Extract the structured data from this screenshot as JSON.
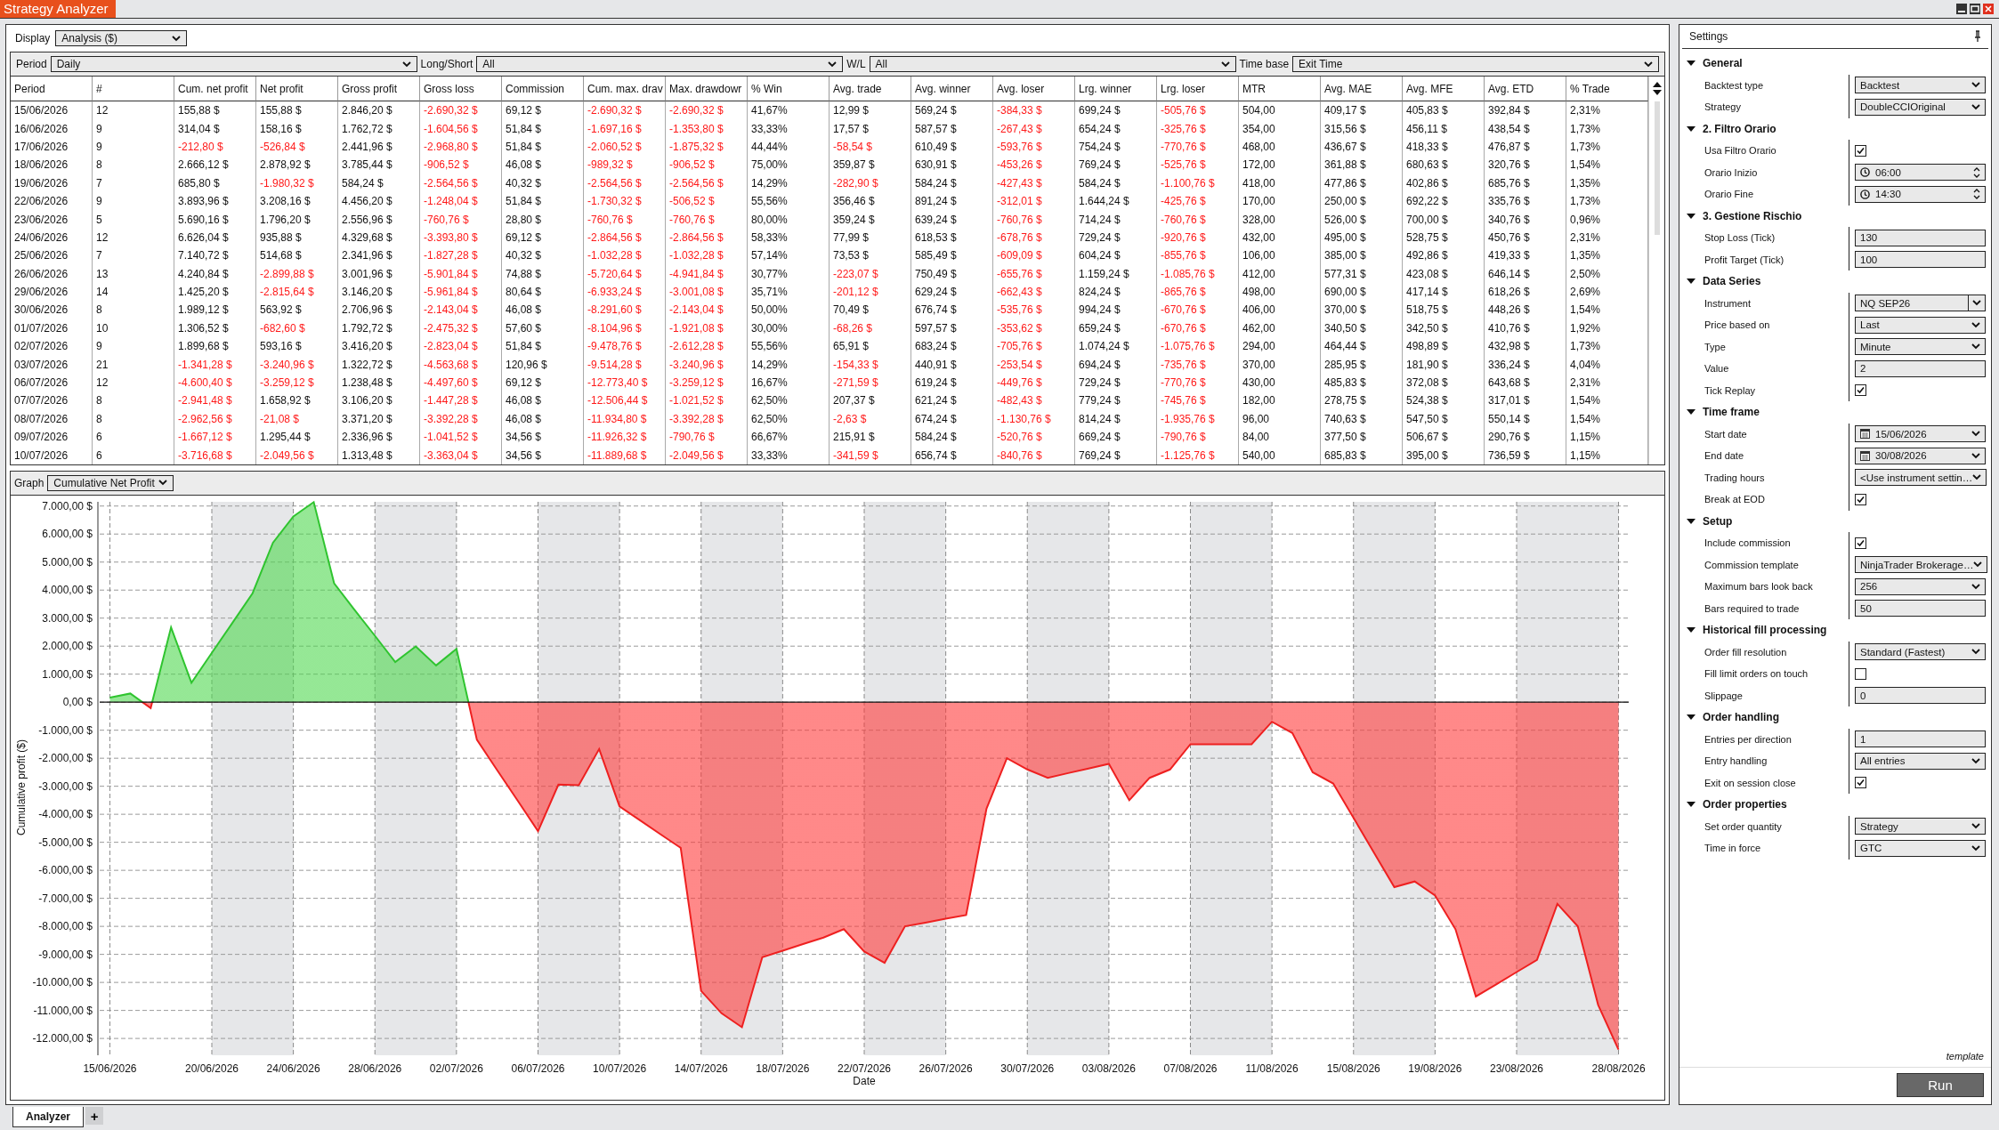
{
  "window": {
    "title": "Strategy Analyzer"
  },
  "display": {
    "label": "Display",
    "value": "Analysis ($)"
  },
  "filters": [
    {
      "label": "Period",
      "value": "Daily"
    },
    {
      "label": "Long/Short",
      "value": "All"
    },
    {
      "label": "W/L",
      "value": "All"
    },
    {
      "label": "Time base",
      "value": "Exit Time"
    }
  ],
  "table": {
    "columns": [
      "Period",
      "#",
      "Cum. net profit",
      "Net profit",
      "Gross profit",
      "Gross loss",
      "Commission",
      "Cum. max. drav",
      "Max. drawdowr",
      "% Win",
      "Avg. trade",
      "Avg. winner",
      "Avg. loser",
      "Lrg. winner",
      "Lrg. loser",
      "MTR",
      "Avg. MAE",
      "Avg. MFE",
      "Avg. ETD",
      "% Trade"
    ],
    "rows": [
      [
        "15/06/2026",
        "12",
        "155,88 $",
        "155,88 $",
        "2.846,20 $",
        "-2.690,32 $",
        "69,12 $",
        "-2.690,32 $",
        "-2.690,32 $",
        "41,67%",
        "12,99 $",
        "569,24 $",
        "-384,33 $",
        "699,24 $",
        "-505,76 $",
        "504,00",
        "409,17 $",
        "405,83 $",
        "392,84 $",
        "2,31%"
      ],
      [
        "16/06/2026",
        "9",
        "314,04 $",
        "158,16 $",
        "1.762,72 $",
        "-1.604,56 $",
        "51,84 $",
        "-1.697,16 $",
        "-1.353,80 $",
        "33,33%",
        "17,57 $",
        "587,57 $",
        "-267,43 $",
        "654,24 $",
        "-325,76 $",
        "354,00",
        "315,56 $",
        "456,11 $",
        "438,54 $",
        "1,73%"
      ],
      [
        "17/06/2026",
        "9",
        "-212,80 $",
        "-526,84 $",
        "2.441,96 $",
        "-2.968,80 $",
        "51,84 $",
        "-2.060,52 $",
        "-1.875,32 $",
        "44,44%",
        "-58,54 $",
        "610,49 $",
        "-593,76 $",
        "754,24 $",
        "-770,76 $",
        "468,00",
        "436,67 $",
        "418,33 $",
        "476,87 $",
        "1,73%"
      ],
      [
        "18/06/2026",
        "8",
        "2.666,12 $",
        "2.878,92 $",
        "3.785,44 $",
        "-906,52 $",
        "46,08 $",
        "-989,32 $",
        "-906,52 $",
        "75,00%",
        "359,87 $",
        "630,91 $",
        "-453,26 $",
        "769,24 $",
        "-525,76 $",
        "172,00",
        "361,88 $",
        "680,63 $",
        "320,76 $",
        "1,54%"
      ],
      [
        "19/06/2026",
        "7",
        "685,80 $",
        "-1.980,32 $",
        "584,24 $",
        "-2.564,56 $",
        "40,32 $",
        "-2.564,56 $",
        "-2.564,56 $",
        "14,29%",
        "-282,90 $",
        "584,24 $",
        "-427,43 $",
        "584,24 $",
        "-1.100,76 $",
        "418,00",
        "477,86 $",
        "402,86 $",
        "685,76 $",
        "1,35%"
      ],
      [
        "22/06/2026",
        "9",
        "3.893,96 $",
        "3.208,16 $",
        "4.456,20 $",
        "-1.248,04 $",
        "51,84 $",
        "-1.730,32 $",
        "-506,52 $",
        "55,56%",
        "356,46 $",
        "891,24 $",
        "-312,01 $",
        "1.644,24 $",
        "-425,76 $",
        "170,00",
        "250,00 $",
        "692,22 $",
        "335,76 $",
        "1,73%"
      ],
      [
        "23/06/2026",
        "5",
        "5.690,16 $",
        "1.796,20 $",
        "2.556,96 $",
        "-760,76 $",
        "28,80 $",
        "-760,76 $",
        "-760,76 $",
        "80,00%",
        "359,24 $",
        "639,24 $",
        "-760,76 $",
        "714,24 $",
        "-760,76 $",
        "328,00",
        "526,00 $",
        "700,00 $",
        "340,76 $",
        "0,96%"
      ],
      [
        "24/06/2026",
        "12",
        "6.626,04 $",
        "935,88 $",
        "4.329,68 $",
        "-3.393,80 $",
        "69,12 $",
        "-2.864,56 $",
        "-2.864,56 $",
        "58,33%",
        "77,99 $",
        "618,53 $",
        "-678,76 $",
        "729,24 $",
        "-920,76 $",
        "432,00",
        "495,00 $",
        "528,75 $",
        "450,76 $",
        "2,31%"
      ],
      [
        "25/06/2026",
        "7",
        "7.140,72 $",
        "514,68 $",
        "2.341,96 $",
        "-1.827,28 $",
        "40,32 $",
        "-1.032,28 $",
        "-1.032,28 $",
        "57,14%",
        "73,53 $",
        "585,49 $",
        "-609,09 $",
        "604,24 $",
        "-855,76 $",
        "106,00",
        "385,00 $",
        "492,86 $",
        "419,33 $",
        "1,35%"
      ],
      [
        "26/06/2026",
        "13",
        "4.240,84 $",
        "-2.899,88 $",
        "3.001,96 $",
        "-5.901,84 $",
        "74,88 $",
        "-5.720,64 $",
        "-4.941,84 $",
        "30,77%",
        "-223,07 $",
        "750,49 $",
        "-655,76 $",
        "1.159,24 $",
        "-1.085,76 $",
        "412,00",
        "577,31 $",
        "423,08 $",
        "646,14 $",
        "2,50%"
      ],
      [
        "29/06/2026",
        "14",
        "1.425,20 $",
        "-2.815,64 $",
        "3.146,20 $",
        "-5.961,84 $",
        "80,64 $",
        "-6.933,24 $",
        "-3.001,08 $",
        "35,71%",
        "-201,12 $",
        "629,24 $",
        "-662,43 $",
        "824,24 $",
        "-865,76 $",
        "498,00",
        "690,00 $",
        "417,14 $",
        "618,26 $",
        "2,69%"
      ],
      [
        "30/06/2026",
        "8",
        "1.989,12 $",
        "563,92 $",
        "2.706,96 $",
        "-2.143,04 $",
        "46,08 $",
        "-8.291,60 $",
        "-2.143,04 $",
        "50,00%",
        "70,49 $",
        "676,74 $",
        "-535,76 $",
        "994,24 $",
        "-670,76 $",
        "406,00",
        "370,00 $",
        "518,75 $",
        "448,26 $",
        "1,54%"
      ],
      [
        "01/07/2026",
        "10",
        "1.306,52 $",
        "-682,60 $",
        "1.792,72 $",
        "-2.475,32 $",
        "57,60 $",
        "-8.104,96 $",
        "-1.921,08 $",
        "30,00%",
        "-68,26 $",
        "597,57 $",
        "-353,62 $",
        "659,24 $",
        "-670,76 $",
        "462,00",
        "340,50 $",
        "342,50 $",
        "410,76 $",
        "1,92%"
      ],
      [
        "02/07/2026",
        "9",
        "1.899,68 $",
        "593,16 $",
        "3.416,20 $",
        "-2.823,04 $",
        "51,84 $",
        "-9.478,76 $",
        "-2.612,28 $",
        "55,56%",
        "65,91 $",
        "683,24 $",
        "-705,76 $",
        "1.074,24 $",
        "-1.075,76 $",
        "294,00",
        "464,44 $",
        "498,89 $",
        "432,98 $",
        "1,73%"
      ],
      [
        "03/07/2026",
        "21",
        "-1.341,28 $",
        "-3.240,96 $",
        "1.322,72 $",
        "-4.563,68 $",
        "120,96 $",
        "-9.514,28 $",
        "-3.240,96 $",
        "14,29%",
        "-154,33 $",
        "440,91 $",
        "-253,54 $",
        "694,24 $",
        "-735,76 $",
        "370,00",
        "285,95 $",
        "181,90 $",
        "336,24 $",
        "4,04%"
      ],
      [
        "06/07/2026",
        "12",
        "-4.600,40 $",
        "-3.259,12 $",
        "1.238,48 $",
        "-4.497,60 $",
        "69,12 $",
        "-12.773,40 $",
        "-3.259,12 $",
        "16,67%",
        "-271,59 $",
        "619,24 $",
        "-449,76 $",
        "729,24 $",
        "-770,76 $",
        "430,00",
        "485,83 $",
        "372,08 $",
        "643,68 $",
        "2,31%"
      ],
      [
        "07/07/2026",
        "8",
        "-2.941,48 $",
        "1.658,92 $",
        "3.106,20 $",
        "-1.447,28 $",
        "46,08 $",
        "-12.506,44 $",
        "-1.021,52 $",
        "62,50%",
        "207,37 $",
        "621,24 $",
        "-482,43 $",
        "779,24 $",
        "-745,76 $",
        "182,00",
        "278,75 $",
        "524,38 $",
        "317,01 $",
        "1,54%"
      ],
      [
        "08/07/2026",
        "8",
        "-2.962,56 $",
        "-21,08 $",
        "3.371,20 $",
        "-3.392,28 $",
        "46,08 $",
        "-11.934,80 $",
        "-3.392,28 $",
        "62,50%",
        "-2,63 $",
        "674,24 $",
        "-1.130,76 $",
        "814,24 $",
        "-1.935,76 $",
        "96,00",
        "740,63 $",
        "547,50 $",
        "550,14 $",
        "1,54%"
      ],
      [
        "09/07/2026",
        "6",
        "-1.667,12 $",
        "1.295,44 $",
        "2.336,96 $",
        "-1.041,52 $",
        "34,56 $",
        "-11.926,32 $",
        "-790,76 $",
        "66,67%",
        "215,91 $",
        "584,24 $",
        "-520,76 $",
        "669,24 $",
        "-790,76 $",
        "84,00",
        "377,50 $",
        "506,67 $",
        "290,76 $",
        "1,15%"
      ],
      [
        "10/07/2026",
        "6",
        "-3.716,68 $",
        "-2.049,56 $",
        "1.313,48 $",
        "-3.363,04 $",
        "34,56 $",
        "-11.889,68 $",
        "-2.049,56 $",
        "33,33%",
        "-341,59 $",
        "656,74 $",
        "-840,76 $",
        "769,24 $",
        "-1.125,76 $",
        "540,00",
        "685,83 $",
        "395,00 $",
        "736,59 $",
        "1,15%"
      ]
    ]
  },
  "graph": {
    "label": "Graph",
    "value": "Cumulative Net Profit",
    "chart_data": {
      "type": "area",
      "xlabel": "Date",
      "ylabel": "Cumulative profit ($)",
      "categories": [
        "15/06/2026",
        null,
        null,
        null,
        null,
        "20/06/2026",
        null,
        null,
        null,
        "24/06/2026",
        null,
        null,
        null,
        "28/06/2026",
        null,
        null,
        null,
        "02/07/2026",
        null,
        null,
        null,
        "06/07/2026",
        null,
        null,
        null,
        "10/07/2026",
        null,
        null,
        null,
        "14/07/2026",
        null,
        null,
        null,
        "18/07/2026",
        null,
        null,
        null,
        "22/07/2026",
        null,
        null,
        null,
        "26/07/2026",
        null,
        null,
        null,
        "30/07/2026",
        null,
        null,
        null,
        "03/08/2026",
        null,
        null,
        null,
        "07/08/2026",
        null,
        null,
        null,
        "11/08/2026",
        null,
        null,
        null,
        "15/08/2026",
        null,
        null,
        null,
        "19/08/2026",
        null,
        null,
        null,
        "23/08/2026",
        null,
        null,
        null,
        null,
        "28/08/2026"
      ],
      "series": [
        {
          "values": [
            160,
            310,
            -210,
            2670,
            690,
            1760,
            2820,
            3890,
            5690,
            6630,
            7140,
            4240,
            3300,
            2370,
            1430,
            1990,
            1310,
            1900,
            -1340,
            -2430,
            -3510,
            -4600,
            -2940,
            -2960,
            -1670,
            -3720,
            -4210,
            -4710,
            -5200,
            -10300,
            -11100,
            -11600,
            -9100,
            -8870,
            -8630,
            -8400,
            -8100,
            -8900,
            -9300,
            -8000,
            -7870,
            -7730,
            -7600,
            -3800,
            -2000,
            -2400,
            -2700,
            -2530,
            -2370,
            -2200,
            -3500,
            -2700,
            -2400,
            -1500,
            -1500,
            -1500,
            -1500,
            -700,
            -1100,
            -2500,
            -2900,
            -4130,
            -5370,
            -6600,
            -6400,
            -6900,
            -8100,
            -10500,
            -10070,
            -9630,
            -9200,
            -7200,
            -8000,
            -10800,
            -12400
          ]
        }
      ],
      "ylim": [
        -12600,
        7150
      ],
      "yticks": [
        {
          "value": 7000,
          "label": "7.000,00 $"
        },
        {
          "value": 6000,
          "label": "6.000,00 $"
        },
        {
          "value": 5000,
          "label": "5.000,00 $"
        },
        {
          "value": 4000,
          "label": "4.000,00 $"
        },
        {
          "value": 3000,
          "label": "3.000,00 $"
        },
        {
          "value": 2000,
          "label": "2.000,00 $"
        },
        {
          "value": 1000,
          "label": "1.000,00 $"
        },
        {
          "value": 0,
          "label": "0,00 $"
        },
        {
          "value": -1000,
          "label": "-1.000,00 $"
        },
        {
          "value": -2000,
          "label": "-2.000,00 $"
        },
        {
          "value": -3000,
          "label": "-3.000,00 $"
        },
        {
          "value": -4000,
          "label": "-4.000,00 $"
        },
        {
          "value": -5000,
          "label": "-5.000,00 $"
        },
        {
          "value": -6000,
          "label": "-6.000,00 $"
        },
        {
          "value": -7000,
          "label": "-7.000,00 $"
        },
        {
          "value": -8000,
          "label": "-8.000,00 $"
        },
        {
          "value": -9000,
          "label": "-9.000,00 $"
        },
        {
          "value": -10000,
          "label": "-10.000,00 $"
        },
        {
          "value": -11000,
          "label": "-11.000,00 $"
        },
        {
          "value": -12000,
          "label": "-12.000,00 $"
        }
      ],
      "grid": true
    }
  },
  "settings": {
    "title": "Settings",
    "groups": [
      {
        "title": "General",
        "expanded": true,
        "rows": [
          {
            "label": "Backtest type",
            "kind": "dropdown",
            "value": "Backtest"
          },
          {
            "label": "Strategy",
            "kind": "dropdown",
            "value": "DoubleCCIOriginal"
          }
        ]
      },
      {
        "title": "2. Filtro Orario",
        "expanded": true,
        "rows": [
          {
            "label": "Usa Filtro Orario",
            "kind": "checkbox",
            "checked": true
          },
          {
            "label": "Orario Inizio",
            "kind": "time",
            "value": "06:00"
          },
          {
            "label": "Orario Fine",
            "kind": "time",
            "value": "14:30"
          }
        ]
      },
      {
        "title": "3. Gestione Rischio",
        "expanded": true,
        "rows": [
          {
            "label": "Stop Loss (Tick)",
            "kind": "text",
            "value": "130"
          },
          {
            "label": "Profit Target (Tick)",
            "kind": "text",
            "value": "100"
          }
        ]
      },
      {
        "title": "Data Series",
        "expanded": true,
        "rows": [
          {
            "label": "Instrument",
            "kind": "combo",
            "value": "NQ SEP26"
          },
          {
            "label": "Price based on",
            "kind": "dropdown",
            "value": "Last"
          },
          {
            "label": "Type",
            "kind": "dropdown",
            "value": "Minute"
          },
          {
            "label": "Value",
            "kind": "text",
            "value": "2"
          },
          {
            "label": "Tick Replay",
            "kind": "checkbox",
            "checked": true
          }
        ]
      },
      {
        "title": "Time frame",
        "expanded": true,
        "rows": [
          {
            "label": "Start date",
            "kind": "date",
            "value": "15/06/2026"
          },
          {
            "label": "End date",
            "kind": "date",
            "value": "30/08/2026"
          },
          {
            "label": "Trading hours",
            "kind": "dropdown",
            "value": "<Use instrument settin…"
          },
          {
            "label": "Break at EOD",
            "kind": "checkbox",
            "checked": true
          }
        ]
      },
      {
        "title": "Setup",
        "expanded": true,
        "rows": [
          {
            "label": "Include commission",
            "kind": "checkbox",
            "checked": true
          },
          {
            "label": "Commission template",
            "kind": "dropdown",
            "value": "NinjaTrader Brokerage…"
          },
          {
            "label": "Maximum bars look back",
            "kind": "dropdown",
            "value": "256"
          },
          {
            "label": "Bars required to trade",
            "kind": "text",
            "value": "50"
          }
        ]
      },
      {
        "title": "Historical fill processing",
        "expanded": true,
        "rows": [
          {
            "label": "Order fill resolution",
            "kind": "dropdown",
            "value": "Standard (Fastest)"
          },
          {
            "label": "Fill limit orders on touch",
            "kind": "checkbox",
            "checked": false
          },
          {
            "label": "Slippage",
            "kind": "text",
            "value": "0"
          }
        ]
      },
      {
        "title": "Order handling",
        "expanded": true,
        "rows": [
          {
            "label": "Entries per direction",
            "kind": "text",
            "value": "1"
          },
          {
            "label": "Entry handling",
            "kind": "dropdown",
            "value": "All entries"
          },
          {
            "label": "Exit on session close",
            "kind": "checkbox",
            "checked": true
          }
        ]
      },
      {
        "title": "Order properties",
        "expanded": true,
        "rows": [
          {
            "label": "Set order quantity",
            "kind": "dropdown",
            "value": "Strategy"
          },
          {
            "label": "Time in force",
            "kind": "dropdown",
            "value": "GTC"
          }
        ]
      }
    ],
    "template_label": "template",
    "run_button": "Run"
  },
  "bottom_tabs": [
    {
      "label": "Analyzer",
      "selected": true
    }
  ],
  "add_tab_button": "+"
}
